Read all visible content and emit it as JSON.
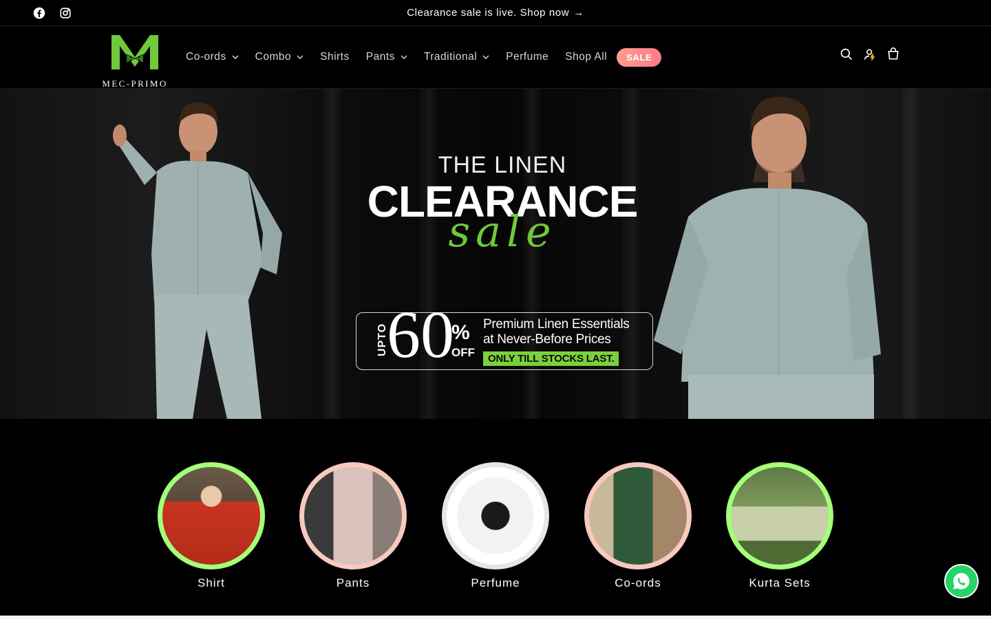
{
  "announcement": {
    "text": "Clearance sale is live. Shop now",
    "arrow": "→",
    "social": [
      "facebook-icon",
      "instagram-icon"
    ]
  },
  "header": {
    "logo_text": "MEC-PRIMO",
    "nav": [
      {
        "label": "Co-ords",
        "dropdown": true
      },
      {
        "label": "Combo",
        "dropdown": true
      },
      {
        "label": "Shirts",
        "dropdown": false
      },
      {
        "label": "Pants",
        "dropdown": true
      },
      {
        "label": "Traditional",
        "dropdown": true
      },
      {
        "label": "Perfume",
        "dropdown": false
      },
      {
        "label": "Shop All",
        "dropdown": false
      }
    ],
    "sale_badge": "SALE",
    "icons": [
      "search-icon",
      "account-icon",
      "cart-icon"
    ]
  },
  "hero": {
    "line1": "THE LINEN",
    "line2": "CLEARANCE",
    "line3": "sale",
    "upto": "UPTO",
    "discount": "60",
    "percent": "%",
    "off": "OFF",
    "copy1": "Premium Linen Essentials",
    "copy2": "at Never-Before Prices",
    "tag": "ONLY TILL STOCKS LAST."
  },
  "categories": [
    {
      "label": "Shirt",
      "ring": "#a4ff7a"
    },
    {
      "label": "Pants",
      "ring": "#f8c9bf"
    },
    {
      "label": "Perfume",
      "ring": "#e6e6e6"
    },
    {
      "label": "Co-ords",
      "ring": "#f8c9bf"
    },
    {
      "label": "Kurta Sets",
      "ring": "#a4ff7a"
    }
  ],
  "colors": {
    "accent_green": "#6fc93a",
    "sale_pink": "#ff8a8a",
    "whatsapp": "#25d366"
  }
}
